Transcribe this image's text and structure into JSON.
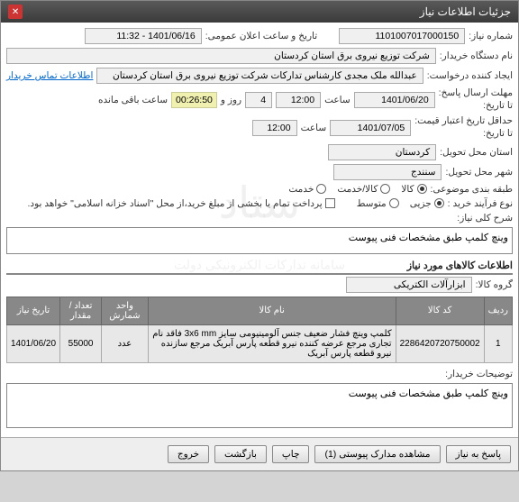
{
  "window": {
    "title": "جزئیات اطلاعات نیاز"
  },
  "fields": {
    "need_number_label": "شماره نیاز:",
    "need_number": "1101007017000150",
    "announce_label": "تاریخ و ساعت اعلان عمومی:",
    "announce_value": "1401/06/16 - 11:32",
    "buyer_label": "نام دستگاه خریدار:",
    "buyer_value": "شرکت توزیع نیروی برق استان کردستان",
    "requester_label": "ایجاد کننده درخواست:",
    "requester_value": "عبدالله ملک مجدی کارشناس تدارکات شرکت توزیع نیروی برق استان کردستان",
    "contact_link": "اطلاعات تماس خریدار",
    "deadline_label": "مهلت ارسال پاسخ:",
    "deadline_sub": "تا تاریخ:",
    "deadline_date": "1401/06/20",
    "time_label": "ساعت",
    "deadline_time": "12:00",
    "days_value": "4",
    "days_label": "روز و",
    "timer": "00:26:50",
    "remaining_label": "ساعت باقی مانده",
    "validity_label": "حداقل تاریخ اعتبار قیمت:",
    "validity_sub": "تا تاریخ:",
    "validity_date": "1401/07/05",
    "validity_time": "12:00",
    "province_label": "استان محل تحویل:",
    "province_value": "کردستان",
    "city_label": "شهر محل تحویل:",
    "city_value": "سنندج",
    "category_label": "طبقه بندی موضوعی:",
    "cat_goods": "کالا",
    "cat_service": "کالا/خدمت",
    "cat_only_service": "خدمت",
    "process_label": "نوع فرآیند خرید :",
    "proc_partial": "جزیی",
    "proc_medium": "متوسط",
    "payment_note": "پرداخت تمام یا بخشی از مبلغ خرید،از محل \"اسناد خزانه اسلامی\" خواهد بود.",
    "summary_label": "شرح کلی نیاز:",
    "summary_text": "وینچ کلمپ طبق مشخصات فنی پیوست",
    "items_header": "اطلاعات کالاهای مورد نیاز",
    "group_label": "گروه کالا:",
    "group_value": "ابزارآلات الکتریکی"
  },
  "table": {
    "headers": [
      "ردیف",
      "کد کالا",
      "نام کالا",
      "واحد شمارش",
      "تعداد / مقدار",
      "تاریخ نیاز"
    ],
    "rows": [
      {
        "idx": "1",
        "code": "2286420720750002",
        "name": "کلمپ وینچ فشار ضعیف جنس آلومینیومی سایز 3x6 mm فاقد نام تجاری مرجع عرضه کننده نیرو قطعه پارس آبریک مرجع سازنده نیرو قطعه پارس آبریک",
        "unit": "عدد",
        "qty": "55000",
        "date": "1401/06/20"
      }
    ]
  },
  "buyer_notes_label": "توضیحات خریدار:",
  "buyer_notes": "وینچ کلمپ طبق مشخصات فنی پیوست",
  "buttons": {
    "respond": "پاسخ به نیاز",
    "attachments": "مشاهده مدارک پیوستی (1)",
    "print": "چاپ",
    "back": "بازگشت",
    "exit": "خروج"
  },
  "watermark": "ستاد\nسامانه تدارکات الکترونیکی دولت"
}
